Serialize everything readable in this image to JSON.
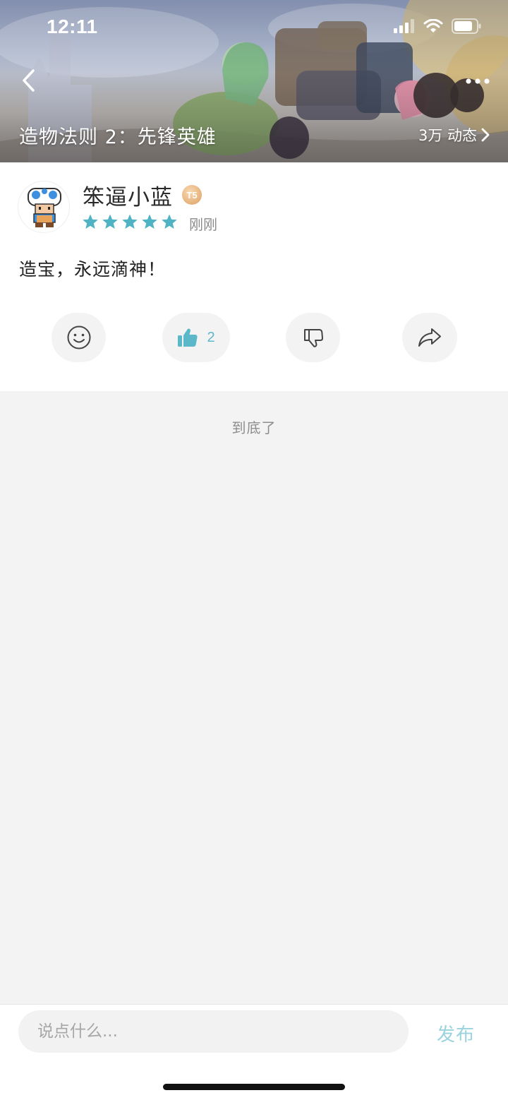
{
  "status_bar": {
    "time": "12:11"
  },
  "header": {
    "game_title": "造物法则 2：先锋英雄",
    "dynamics_count": "3万 动态",
    "back_icon": "chevron-left-icon",
    "more_icon": "more-dots-icon"
  },
  "post": {
    "author": "笨逼小蓝",
    "level_badge": "T5",
    "rating_stars": 5,
    "time": "刚刚",
    "content": "造宝，永远滴神！",
    "actions": {
      "emoji_icon": "smile-icon",
      "like_icon": "thumbs-up-icon",
      "like_count": "2",
      "dislike_icon": "thumbs-down-icon",
      "share_icon": "share-icon"
    }
  },
  "footer": {
    "end_of_list": "到底了"
  },
  "composer": {
    "placeholder": "说点什么...",
    "publish_label": "发布"
  },
  "colors": {
    "accent": "#5bb8c9",
    "publish_disabled": "#9ad3de",
    "star": "#4fb3c4"
  }
}
